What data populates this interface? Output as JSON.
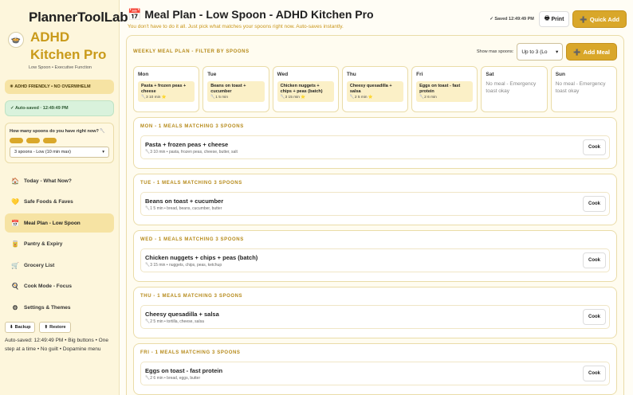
{
  "sidebar": {
    "app_name": "PlannerToolLab",
    "app_subtitle": "ADHD Kitchen Pro",
    "tagline": "Low Spoon • Executive Function",
    "adhd_badge": "ADHD FRIENDLY • NO OVERWHELM",
    "autosave_badge": "Auto-saved · 12:49:49 PM",
    "spoon_question": "How many spoons do you have right now?",
    "spoon_count": 3,
    "spoon_select": "3 spoons - Low (10 min max)",
    "nav": [
      {
        "label": "Today - What Now?",
        "icon": "house-icon",
        "glyph": "🏠",
        "active": false
      },
      {
        "label": "Safe Foods & Faves",
        "icon": "heart-icon",
        "glyph": "💛",
        "active": false
      },
      {
        "label": "Meal Plan - Low Spoon",
        "icon": "calendar-icon",
        "glyph": "📅",
        "active": true
      },
      {
        "label": "Pantry & Expiry",
        "icon": "jar-icon",
        "glyph": "🥫",
        "active": false
      },
      {
        "label": "Grocery List",
        "icon": "cart-icon",
        "glyph": "🛒",
        "active": false
      },
      {
        "label": "Cook Mode - Focus",
        "icon": "pot-icon",
        "glyph": "🍳",
        "active": false
      },
      {
        "label": "Settings & Themes",
        "icon": "gear-icon",
        "glyph": "⚙",
        "active": false
      }
    ],
    "backup_label": "Backup",
    "restore_label": "Restore",
    "footer": "Auto-saved: 12:49:49 PM • Big buttons • One step at a time • No guilt • Dopamine menu"
  },
  "header": {
    "title": "Meal Plan - Low Spoon - ADHD Kitchen Pro",
    "subtitle": "You don't have to do it all. Just pick what matches your spoons right now. Auto-saves instantly.",
    "saved": "Saved 12:49:49 PM",
    "print_label": "Print",
    "quick_add_label": "Quick Add"
  },
  "weekly": {
    "title": "WEEKLY MEAL PLAN - FILTER BY SPOONS",
    "show_max_label": "Show max spoons:",
    "max_select": "Up to 3 (Lo",
    "add_meal_label": "Add Meal",
    "days": [
      {
        "name": "Mon",
        "meal": "Pasta + frozen peas + cheese",
        "meta": "3 10 min ⭐"
      },
      {
        "name": "Tue",
        "meal": "Beans on toast + cucumber",
        "meta": "1 5 min"
      },
      {
        "name": "Wed",
        "meal": "Chicken nuggets + chips + peas (batch)",
        "meta": "3 15 min ⭐"
      },
      {
        "name": "Thu",
        "meal": "Cheesy quesadilla + salsa",
        "meta": "2 5 min ⭐"
      },
      {
        "name": "Fri",
        "meal": "Eggs on toast - fast protein",
        "meta": "2 6 min"
      },
      {
        "name": "Sat",
        "none": "No meal - Emergency toast okay"
      },
      {
        "name": "Sun",
        "none": "No meal - Emergency toast okay"
      }
    ]
  },
  "sections": [
    {
      "title": "MON - 1 MEALS MATCHING 3 SPOONS",
      "meal": "Pasta + frozen peas + cheese",
      "meta": "3 10 min • pasta, frozen peas, cheese, butter, salt",
      "cook_label": "Cook"
    },
    {
      "title": "TUE - 1 MEALS MATCHING 3 SPOONS",
      "meal": "Beans on toast + cucumber",
      "meta": "1 5 min • bread, beans, cucumber, butter",
      "cook_label": "Cook"
    },
    {
      "title": "WED - 1 MEALS MATCHING 3 SPOONS",
      "meal": "Chicken nuggets + chips + peas (batch)",
      "meta": "3 15 min • nuggets, chips, peas, ketchup",
      "cook_label": "Cook"
    },
    {
      "title": "THU - 1 MEALS MATCHING 3 SPOONS",
      "meal": "Cheesy quesadilla + salsa",
      "meta": "2 5 min • tortilla, cheese, salsa",
      "cook_label": "Cook"
    },
    {
      "title": "FRI - 1 MEALS MATCHING 3 SPOONS",
      "meal": "Eggs on toast - fast protein",
      "meta": "2 6 min • bread, eggs, butter",
      "cook_label": "Cook"
    }
  ],
  "colors": {
    "accent": "#d9a72a",
    "accent_text": "#b68a1a",
    "sidebar_bg": "#fdf6dc",
    "saved_green": "#d9f2dc"
  }
}
